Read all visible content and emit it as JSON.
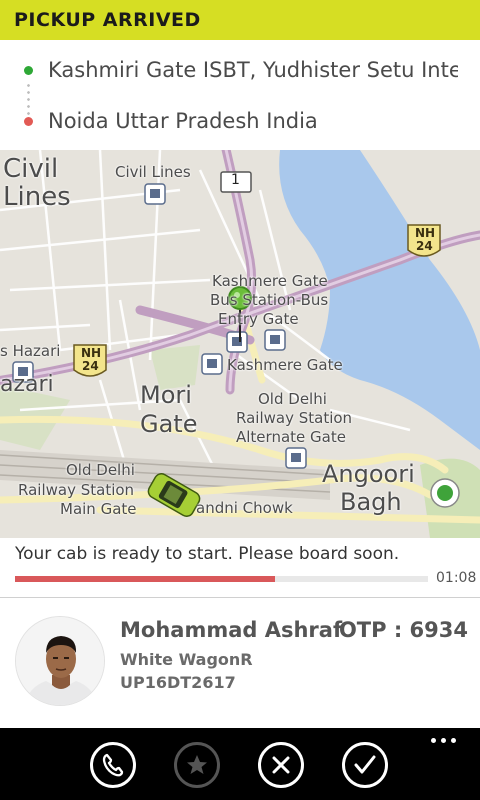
{
  "status": {
    "title": "PICKUP ARRIVED",
    "color": "#d6de23"
  },
  "route": {
    "pickup": "Kashmiri Gate ISBT, Yudhister Setu Inter...",
    "drop": "Noida Uttar Pradesh India"
  },
  "map": {
    "labels": {
      "civil_lines_big": "Civil",
      "civil_lines_big2": "Lines",
      "civil_lines_station": "Civil Lines",
      "road_1": "1",
      "nh24_right": "NH",
      "nh24_right_num": "24",
      "kashmere_gate_bus_1": "Kashmere Gate",
      "kashmere_gate_bus_2": "Bus Station-Bus",
      "kashmere_gate_bus_3": "Entry Gate",
      "hazari": "s Hazari",
      "nh24_left": "NH",
      "nh24_left_num": "24",
      "hazari2": "azari",
      "kashmere_gate_metro": "Kashmere Gate",
      "mori_1": "Mori",
      "mori_2": "Gate",
      "old_delhi_alt_1": "Old Delhi",
      "old_delhi_alt_2": "Railway Station",
      "old_delhi_alt_3": "Alternate Gate",
      "angoori_1": "Angoori",
      "angoori_2": "Bagh",
      "old_delhi_main_1": "Old Delhi",
      "old_delhi_main_2": "Railway Station",
      "old_delhi_main_3": "Main Gate",
      "chandni": "andni Chowk"
    }
  },
  "notice": {
    "message": "Your cab is ready to start. Please board soon.",
    "timer": "01:08",
    "progress": 0.63
  },
  "driver": {
    "name": "Mohammad Ashraf",
    "car": "White WagonR",
    "plate": "UP16DT2617",
    "otp": "OTP : 6934"
  },
  "appbar": {
    "buttons": [
      "call-icon",
      "star-icon",
      "cancel-icon",
      "confirm-icon"
    ],
    "more": "more-icon"
  }
}
